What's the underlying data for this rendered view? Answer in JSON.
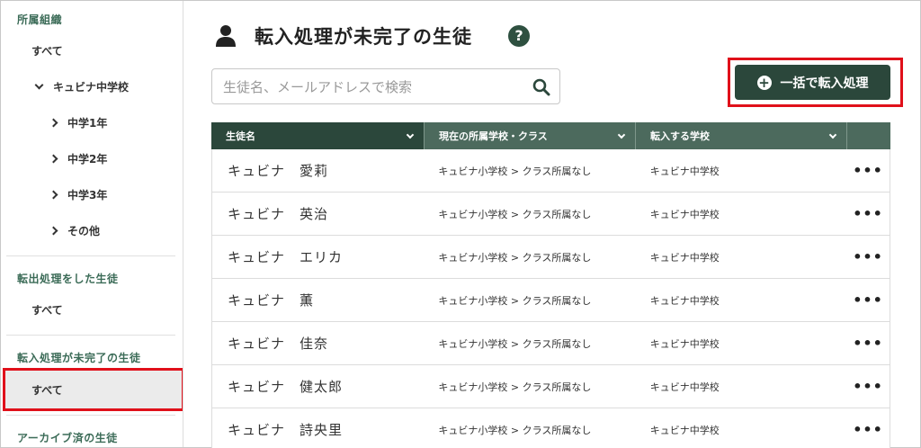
{
  "sidebar": {
    "org_title": "所属組織",
    "org_all": "すべて",
    "school": "キュビナ中学校",
    "grades": [
      "中学1年",
      "中学2年",
      "中学3年",
      "その他"
    ],
    "transfer_out_title": "転出処理をした生徒",
    "transfer_out_all": "すべて",
    "transfer_in_title": "転入処理が未完了の生徒",
    "transfer_in_all": "すべて",
    "archived_title": "アーカイブ済の生徒"
  },
  "header": {
    "title": "転入処理が未完了の生徒",
    "help_icon_text": "?"
  },
  "search": {
    "placeholder": "生徒名、メールアドレスで検索",
    "value": ""
  },
  "bulk_button": {
    "label": "一括で転入処理",
    "icon": "plus-circle-icon"
  },
  "table": {
    "columns": [
      "生徒名",
      "現在の所属学校・クラス",
      "転入する学校"
    ],
    "rows": [
      {
        "name": "キュビナ　愛莉",
        "current": "キュビナ小学校 > クラス所属なし",
        "target": "キュビナ中学校",
        "menu": "•••"
      },
      {
        "name": "キュビナ　英治",
        "current": "キュビナ小学校 > クラス所属なし",
        "target": "キュビナ中学校",
        "menu": "•••"
      },
      {
        "name": "キュビナ　エリカ",
        "current": "キュビナ小学校 > クラス所属なし",
        "target": "キュビナ中学校",
        "menu": "•••"
      },
      {
        "name": "キュビナ　薫",
        "current": "キュビナ小学校 > クラス所属なし",
        "target": "キュビナ中学校",
        "menu": "•••"
      },
      {
        "name": "キュビナ　佳奈",
        "current": "キュビナ小学校 > クラス所属なし",
        "target": "キュビナ中学校",
        "menu": "•••"
      },
      {
        "name": "キュビナ　健太郎",
        "current": "キュビナ小学校 > クラス所属なし",
        "target": "キュビナ中学校",
        "menu": "•••"
      },
      {
        "name": "キュビナ　詩央里",
        "current": "キュビナ小学校 > クラス所属なし",
        "target": "キュビナ中学校",
        "menu": "•••"
      }
    ]
  },
  "colors": {
    "brand_dark": "#2b473b",
    "header_bg": "#4c6a5d",
    "section_title": "#3b6b57",
    "highlight_red": "#e0101a",
    "selected_bg": "#ebebeb"
  }
}
